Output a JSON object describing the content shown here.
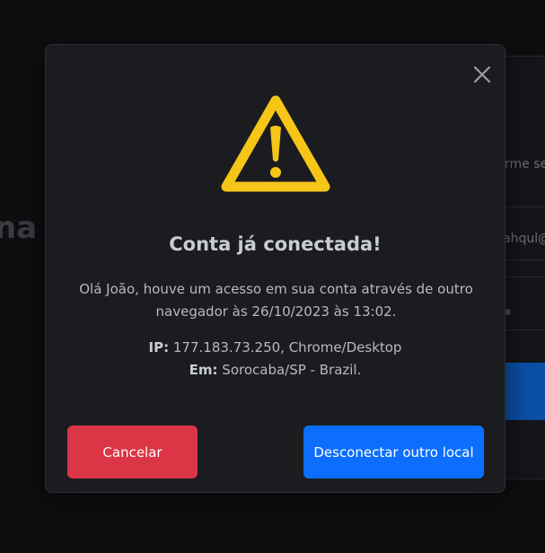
{
  "background": {
    "heading_fragment": "na c",
    "field_text_1": "rme se",
    "field_text_2": "ahqul@"
  },
  "modal": {
    "close_icon": "close-icon",
    "warning_icon": "warning-triangle-icon",
    "warning_color": "#f5c517",
    "title": "Conta já conectada!",
    "message": "Olá João, houve um acesso em sua conta através de outro navegador às 26/10/2023 às 13:02.",
    "ip_label": "IP:",
    "ip_value": "177.183.73.250, Chrome/Desktop",
    "location_label": "Em:",
    "location_value": "Sorocaba/SP - Brazil.",
    "cancel_label": "Cancelar",
    "disconnect_label": "Desconectar outro local",
    "cancel_color": "#dc3545",
    "disconnect_color": "#0d6efd"
  }
}
